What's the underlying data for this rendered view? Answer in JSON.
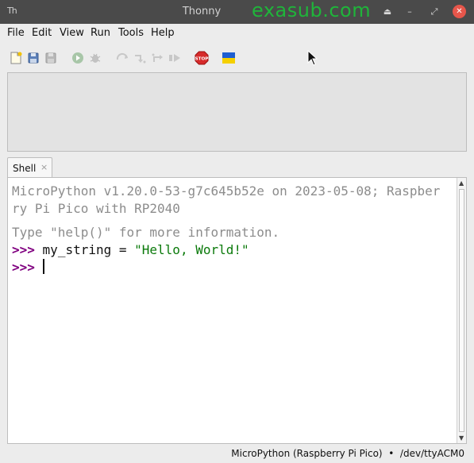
{
  "window": {
    "app_icon_text": "Th",
    "title": "Thonny",
    "watermark": "exasub.com",
    "controls": {
      "shade": "⏏",
      "minimize": "–",
      "maximize": "⤢",
      "close": "✕"
    }
  },
  "menu": [
    "File",
    "Edit",
    "View",
    "Run",
    "Tools",
    "Help"
  ],
  "toolbar": {
    "icons": [
      "new-file-icon",
      "open-file-icon",
      "save-file-icon",
      "run-icon",
      "debug-icon",
      "step-over-icon",
      "step-into-icon",
      "step-out-icon",
      "resume-icon",
      "stop-icon",
      "ukraine-flag-icon"
    ],
    "stop_label": "STOP"
  },
  "shell": {
    "tab_label": "Shell",
    "tab_close": "×",
    "banner_line1": "MicroPython v1.20.0-53-g7c645b52e on 2023-05-08; Raspber",
    "banner_line2": "ry Pi Pico with RP2040",
    "help_line": "Type \"help()\" for more information.",
    "prompt": ">>>",
    "command_code": "my_string = ",
    "command_string": "\"Hello, World!\""
  },
  "statusbar": {
    "text": "MicroPython (Raspberry Pi Pico)  •  /dev/ttyACM0"
  },
  "colors": {
    "titlebar": "#4a4a4a",
    "watermark": "#1fb53a",
    "prompt": "#800080",
    "string": "#0b7a0b",
    "banner": "#8c8c8c",
    "close_button": "#e6564b"
  }
}
